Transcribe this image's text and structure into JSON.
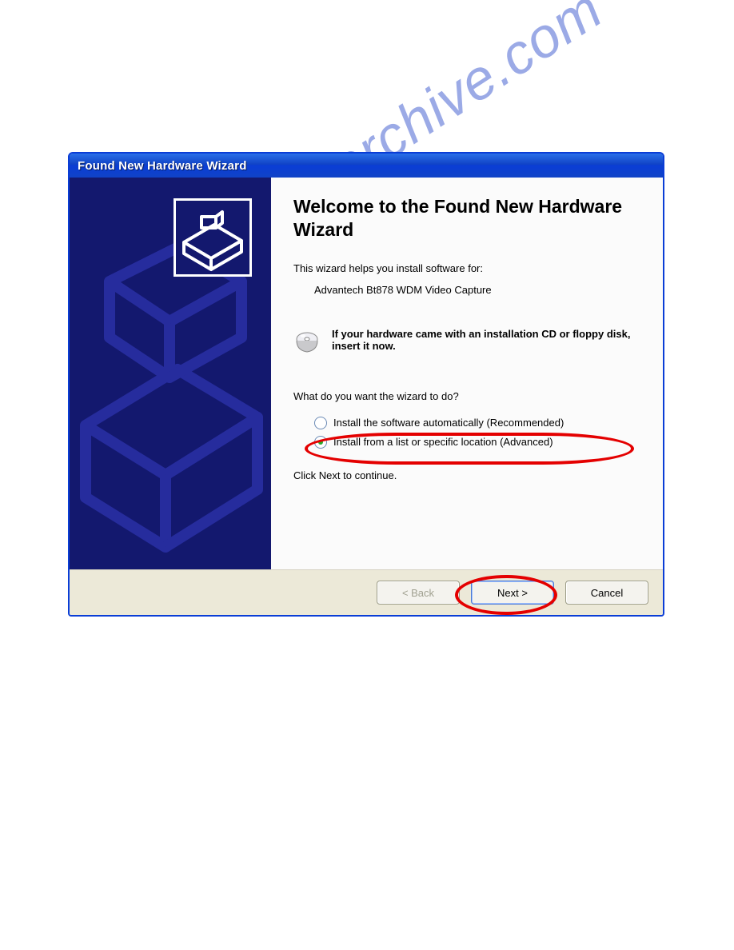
{
  "dialog": {
    "title": "Found New Hardware Wizard",
    "heading": "Welcome to the Found New Hardware Wizard",
    "intro": "This wizard helps you install software for:",
    "device_name": "Advantech Bt878 WDM Video Capture",
    "cd_note": "If your hardware came with an installation CD or floppy disk, insert it now.",
    "question": "What do you want the wizard to do?",
    "radio": {
      "auto": "Install the software automatically (Recommended)",
      "list": "Install from a list or specific location (Advanced)"
    },
    "continue_hint": "Click Next to continue.",
    "buttons": {
      "back": "< Back",
      "next": "Next >",
      "cancel": "Cancel"
    }
  },
  "watermark": "manualsarchive.com"
}
